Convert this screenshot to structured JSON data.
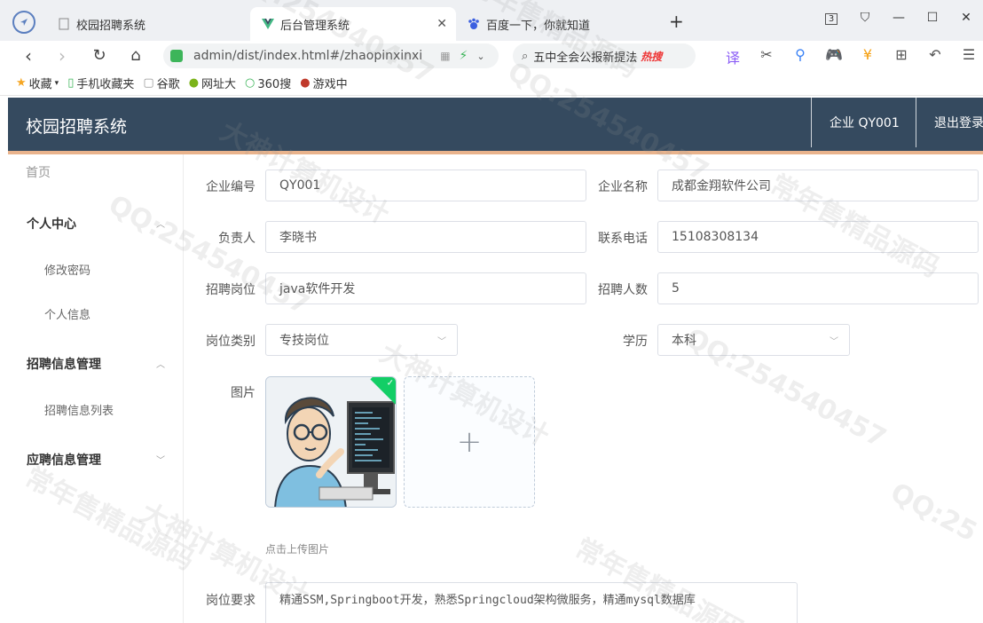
{
  "browser": {
    "tabs": [
      {
        "title": "校园招聘系统",
        "icon": "page-icon"
      },
      {
        "title": "后台管理系统",
        "icon": "vue-logo-icon"
      },
      {
        "title": "百度一下，你就知道",
        "icon": "baidu-paw-icon"
      }
    ],
    "tab_count": "3",
    "url": "admin/dist/index.html#/zhaopinxinxi",
    "search_text": "五中全会公报新提法",
    "hot_badge": "热搜",
    "bookmarks": [
      "收藏",
      "手机收藏夹",
      "谷歌",
      "网址大",
      "360搜",
      "游戏中"
    ]
  },
  "header": {
    "title": "校园招聘系统",
    "user": "企业 QY001",
    "logout": "退出登录"
  },
  "sidebar": {
    "home": "首页",
    "groups": [
      {
        "label": "个人中心",
        "items": [
          "修改密码",
          "个人信息"
        ]
      },
      {
        "label": "招聘信息管理",
        "items": [
          "招聘信息列表"
        ]
      },
      {
        "label": "应聘信息管理",
        "items": []
      }
    ]
  },
  "form": {
    "company_id_label": "企业编号",
    "company_id": "QY001",
    "company_name_label": "企业名称",
    "company_name": "成都金翔软件公司",
    "manager_label": "负责人",
    "manager": "李晓书",
    "phone_label": "联系电话",
    "phone": "15108308134",
    "position_label": "招聘岗位",
    "position": "java软件开发",
    "headcount_label": "招聘人数",
    "headcount": "5",
    "category_label": "岗位类别",
    "category": "专技岗位",
    "education_label": "学历",
    "education": "本科",
    "image_label": "图片",
    "upload_hint": "点击上传图片",
    "requirements_label": "岗位要求",
    "requirements": "精通SSM,Springboot开发，熟悉Springcloud架构微服务，精通mysql数据库"
  },
  "watermarks": [
    "QQ:254540457",
    "常年售精品源码",
    "大神计算机设计",
    "QQ:254540457",
    "常年售精品源码",
    "大神计算机设计",
    "QQ:254540457",
    "常年售精品源码",
    "QQ:254540457",
    "常年售精品源码",
    "大神计算机设计",
    "QQ:25"
  ]
}
